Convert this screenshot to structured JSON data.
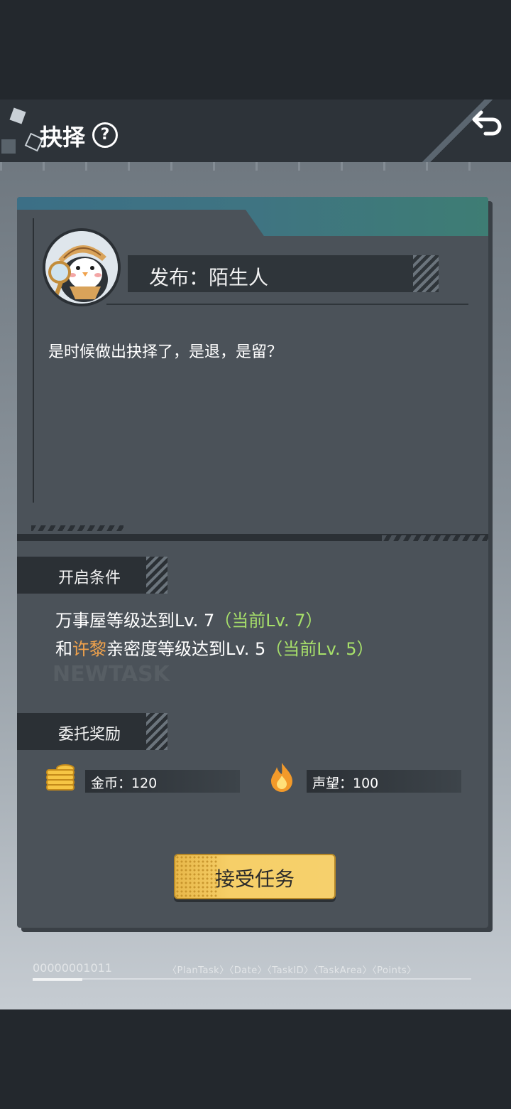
{
  "header": {
    "title": "抉择",
    "help_glyph": "?",
    "back_icon": "back-arrow-icon"
  },
  "publisher": {
    "label": "发布：陌生人",
    "avatar_icon": "detective-penguin-avatar"
  },
  "description": "是时候做出抉择了，是退，是留？",
  "conditions": {
    "section_label": "开启条件",
    "line1": {
      "text": "万事屋等级达到Lv. 7",
      "current": "（当前Lv. 7）"
    },
    "line2": {
      "prefix": "和",
      "name": "许黎",
      "text": "亲密度等级达到Lv. 5",
      "current": "（当前Lv. 5）"
    },
    "watermark": "NEWTASK"
  },
  "rewards": {
    "section_label": "委托奖励",
    "items": [
      {
        "icon": "gold-coins-icon",
        "label": "金币：120"
      },
      {
        "icon": "fire-icon",
        "label": "声望：100"
      }
    ]
  },
  "accept_button": "接受任务",
  "footer": {
    "id": "00000001011",
    "tags": "〈PlanTask〉〈Date〉〈TaskID〉〈TaskArea〉〈Points〉"
  },
  "colors": {
    "accent_green": "#a7e06a",
    "accent_orange": "#f0a24c",
    "button_yellow": "#f6cf68",
    "panel_dark": "#4b5259"
  }
}
